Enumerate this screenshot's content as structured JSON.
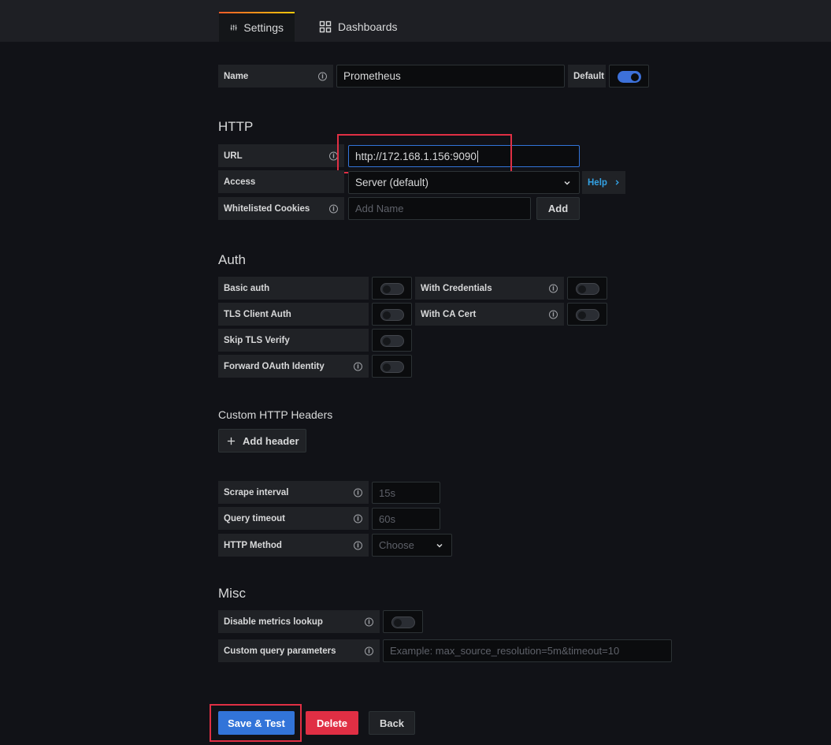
{
  "tabs": {
    "settings": "Settings",
    "dashboards": "Dashboards"
  },
  "name_row": {
    "label": "Name",
    "value": "Prometheus",
    "default_label": "Default",
    "default_on": true
  },
  "http": {
    "title": "HTTP",
    "url_label": "URL",
    "url_value": "http://172.168.1.156:9090",
    "access_label": "Access",
    "access_value": "Server (default)",
    "help_label": "Help",
    "cookies_label": "Whitelisted Cookies",
    "cookies_placeholder": "Add Name",
    "add_label": "Add"
  },
  "auth": {
    "title": "Auth",
    "basic_auth": "Basic auth",
    "with_credentials": "With Credentials",
    "tls_client_auth": "TLS Client Auth",
    "with_ca_cert": "With CA Cert",
    "skip_tls_verify": "Skip TLS Verify",
    "forward_oauth": "Forward OAuth Identity"
  },
  "headers": {
    "title": "Custom HTTP Headers",
    "add_header": "Add header"
  },
  "prometheus": {
    "scrape_label": "Scrape interval",
    "scrape_placeholder": "15s",
    "query_timeout_label": "Query timeout",
    "query_timeout_placeholder": "60s",
    "http_method_label": "HTTP Method",
    "http_method_placeholder": "Choose"
  },
  "misc": {
    "title": "Misc",
    "disable_metrics": "Disable metrics lookup",
    "custom_params": "Custom query parameters",
    "custom_params_placeholder": "Example: max_source_resolution=5m&timeout=10"
  },
  "actions": {
    "save": "Save & Test",
    "delete": "Delete",
    "back": "Back"
  },
  "colors": {
    "primary": "#3274d9",
    "danger": "#e02f44",
    "highlight": "#e02f44"
  }
}
